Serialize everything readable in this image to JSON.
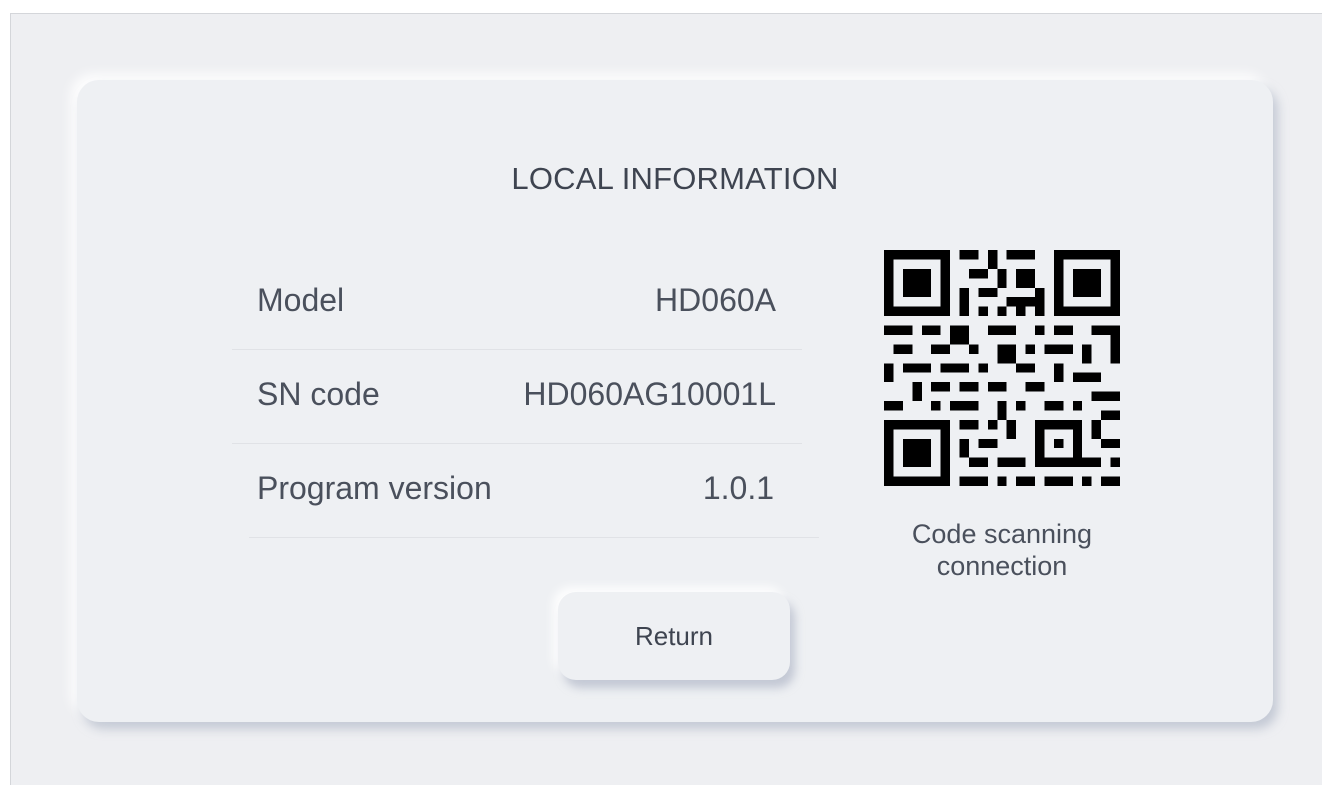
{
  "panel": {
    "title": "LOCAL INFORMATION",
    "rows": [
      {
        "label": "Model",
        "value": "HD060A"
      },
      {
        "label": "SN code",
        "value": "HD060AG10001L"
      },
      {
        "label": "Program version",
        "value": "1.0.1"
      }
    ],
    "qr_caption_line1": "Code scanning",
    "qr_caption_line2": "connection",
    "return_label": "Return"
  },
  "colors": {
    "background": "#eeeff2",
    "text": "#4a505c",
    "qr": "#000000"
  }
}
